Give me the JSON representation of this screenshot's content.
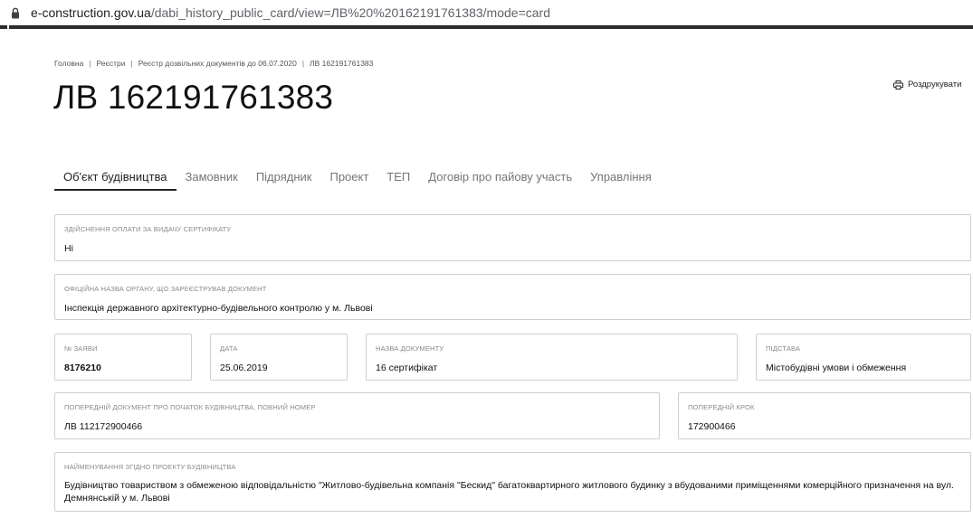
{
  "browser": {
    "url_host": "e-construction.gov.ua",
    "url_path": "/dabi_history_public_card/view=ЛВ%20%20162191761383/mode=card"
  },
  "breadcrumb": [
    "Головна",
    "Реєстри",
    "Реєстр дозвільних документів до 06.07.2020",
    "ЛВ 162191761383"
  ],
  "page_title": "ЛВ 162191761383",
  "print_label": "Роздрукувати",
  "tabs": [
    {
      "label": "Об'єкт будівництва",
      "active": true
    },
    {
      "label": "Замовник",
      "active": false
    },
    {
      "label": "Підрядник",
      "active": false
    },
    {
      "label": "Проект",
      "active": false
    },
    {
      "label": "ТЕП",
      "active": false
    },
    {
      "label": "Договір про пайову участь",
      "active": false
    },
    {
      "label": "Управління",
      "active": false
    }
  ],
  "fields": {
    "payment": {
      "label": "Здійснення оплати за видачу сертифікату",
      "value": "Ні"
    },
    "authority": {
      "label": "Офіційна назва органу, що зареєстрував документ",
      "value": "Інспекція державного архітектурно-будівельного контролю у м. Львові"
    },
    "application_no": {
      "label": "№ заяви",
      "value": "8176210"
    },
    "date": {
      "label": "Дата",
      "value": "25.06.2019"
    },
    "doc_name": {
      "label": "Назва документу",
      "value": "16 сертифікат"
    },
    "basis": {
      "label": "Підстава",
      "value": "Містобудівні умови і обмеження"
    },
    "prev_doc": {
      "label": "Попередній документ про початок будівництва, повний номер",
      "value": "ЛВ 112172900466"
    },
    "prev_step": {
      "label": "Попередній крок",
      "value": "172900466"
    },
    "project_name": {
      "label": "Найменування згідно проекту будівництва",
      "value": "Будівництво товариством з обмеженою відповідальністю \"Житлово-будівельна компанія \"Бескид\" багатоквартирного житлового будинку з вбудованими приміщеннями комерційного призначення на вул. Демнянській у м. Львові"
    }
  }
}
